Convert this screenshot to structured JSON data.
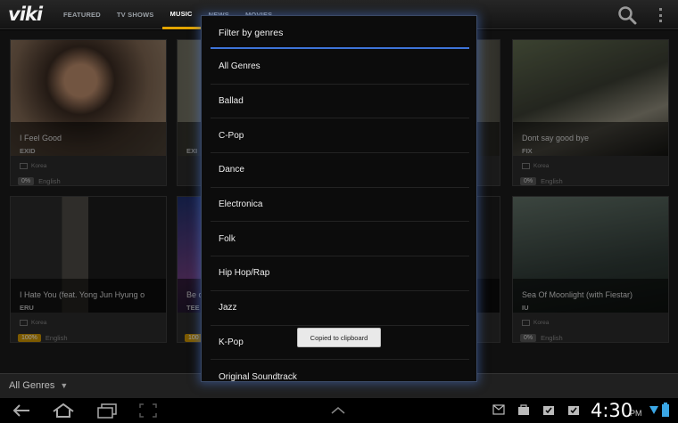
{
  "app": {
    "logo": "viki"
  },
  "nav": {
    "tabs": [
      {
        "label": "FEATURED"
      },
      {
        "label": "TV SHOWS"
      },
      {
        "label": "MUSIC"
      },
      {
        "label": "NEWS"
      },
      {
        "label": "MOVIES"
      }
    ],
    "active": "MUSIC"
  },
  "cards": [
    {
      "title": "I Feel Good",
      "artist": "EXID",
      "country": "Korea",
      "progress": "0%",
      "subtitle": "English"
    },
    {
      "title": "",
      "artist": "EXI",
      "country": "",
      "progress": "",
      "subtitle": ""
    },
    {
      "title": "Dont say good bye",
      "artist": "FIX",
      "country": "Korea",
      "progress": "0%",
      "subtitle": "English"
    },
    {
      "title": "I Hate You (feat. Yong Jun Hyung o",
      "artist": "ERU",
      "country": "Korea",
      "progress": "100%",
      "subtitle": "English"
    },
    {
      "title": "Be o",
      "artist": "TEE",
      "country": "",
      "progress": "100",
      "subtitle": ""
    },
    {
      "title": "Sea Of Moonlight (with Fiestar)",
      "artist": "IU",
      "country": "Korea",
      "progress": "0%",
      "subtitle": "English"
    }
  ],
  "bottom": {
    "genre_select": "All Genres"
  },
  "dialog": {
    "title": "Filter by genres",
    "genres": [
      "All Genres",
      "Ballad",
      "C-Pop",
      "Dance",
      "Electronica",
      "Folk",
      "Hip Hop/Rap",
      "Jazz",
      "K-Pop",
      "Original Soundtrack"
    ]
  },
  "toast": {
    "text": "Copied to clipboard"
  },
  "system": {
    "time": "4:30",
    "ampm": "PM"
  },
  "colors": {
    "accent": "#3e74d8",
    "highlight": "#e2a400",
    "full_badge": "#c99200"
  }
}
